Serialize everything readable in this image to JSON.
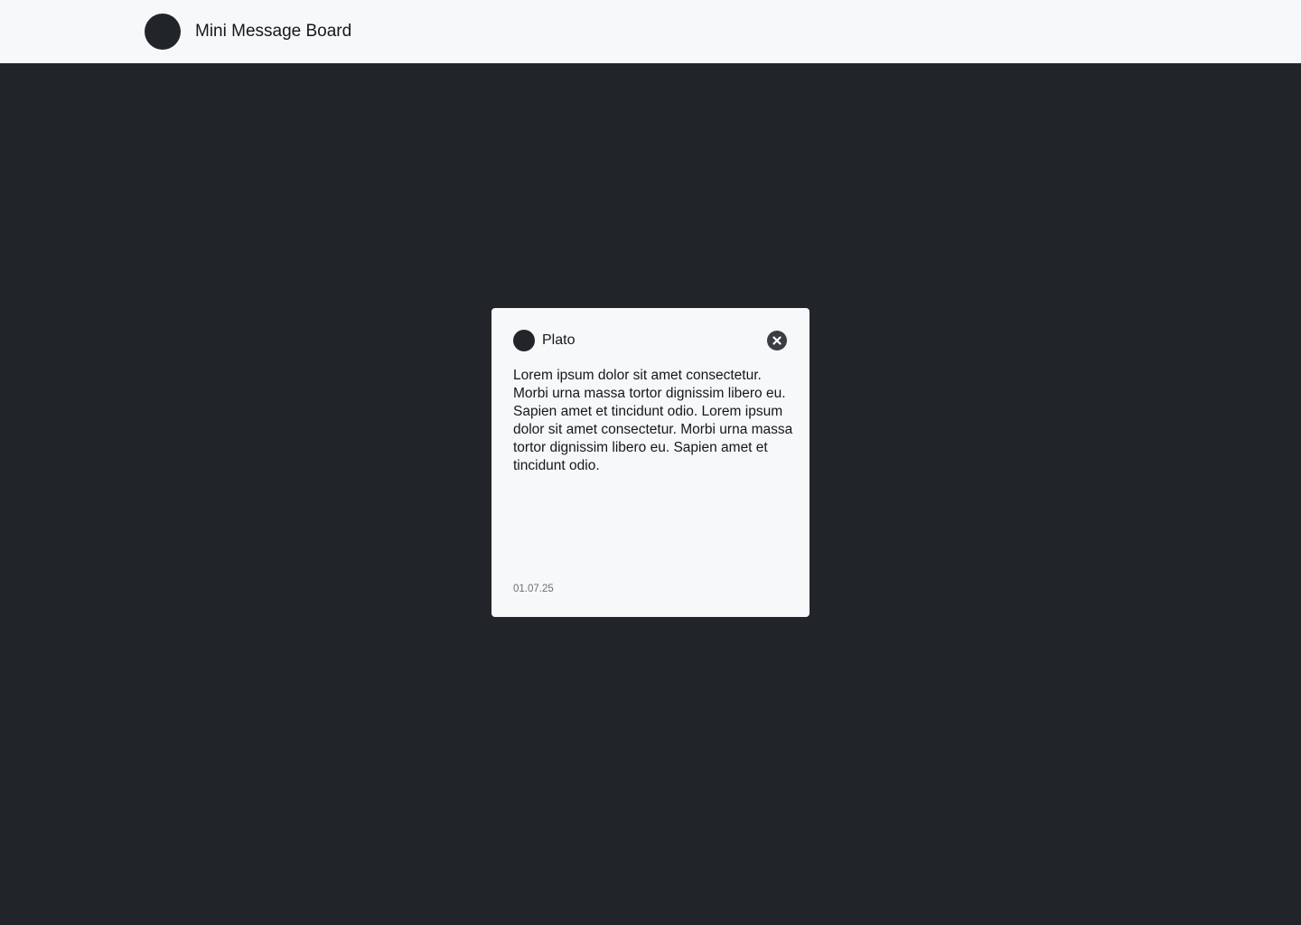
{
  "header": {
    "title": "Mini Message Board",
    "logo_icon": "circle-logo-icon"
  },
  "message": {
    "author": "Plato",
    "avatar_icon": "user-avatar-icon",
    "body": "Lorem ipsum dolor sit amet consectetur. Morbi urna massa tortor dignissim libero eu. Sapien amet et tincidunt odio. Lorem ipsum dolor sit amet consectetur. Morbi urna massa tortor dignissim libero eu. Sapien amet et tincidunt odio.",
    "date": "01.07.25",
    "close_icon": "close-icon"
  },
  "colors": {
    "background_dark": "#212429",
    "surface_light": "#f7f8fa",
    "text_primary": "#15171a",
    "text_muted": "#6c7077",
    "close_button": "#3a3d42"
  }
}
